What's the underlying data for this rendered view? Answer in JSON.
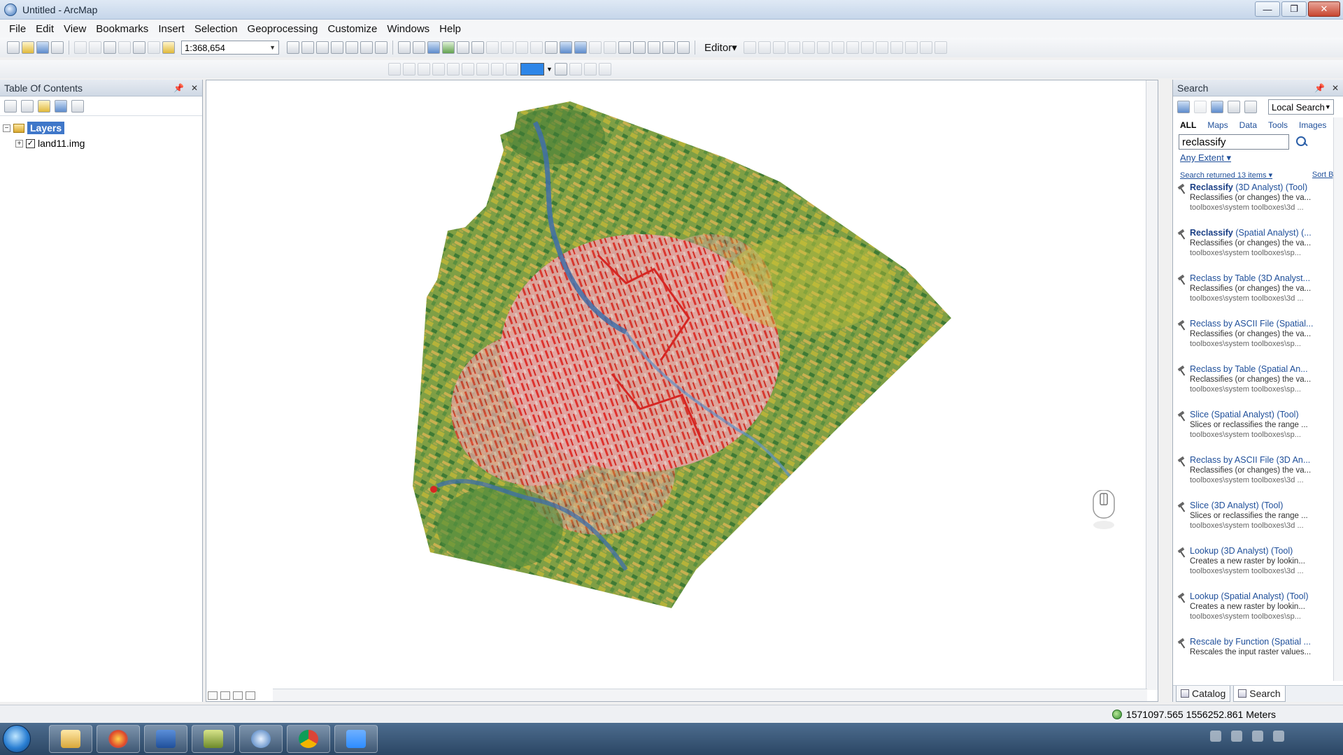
{
  "window": {
    "title": "Untitled - ArcMap",
    "minimize_glyph": "—",
    "restore_glyph": "❐",
    "close_glyph": "✕"
  },
  "menu": [
    "File",
    "Edit",
    "View",
    "Bookmarks",
    "Insert",
    "Selection",
    "Geoprocessing",
    "Customize",
    "Windows",
    "Help"
  ],
  "toolbar": {
    "scale": "1:368,654",
    "editor_label": "Editor▾"
  },
  "toc": {
    "title": "Table Of Contents",
    "tree": {
      "root_label": "Layers",
      "root_expander": "−",
      "layer_label": "land11.img",
      "layer_expander": "+",
      "layer_checked": "✓"
    }
  },
  "search": {
    "title": "Search",
    "scope": "Local Search",
    "filters": [
      "ALL",
      "Maps",
      "Data",
      "Tools",
      "Images"
    ],
    "query": "reclassify",
    "extent": "Any Extent ▾",
    "summary": "Search returned 13 items ▾",
    "sort": "Sort By",
    "results": [
      {
        "title_bold": "Reclassify",
        "title_rest": " (3D Analyst) (Tool)",
        "desc": "Reclassifies (or changes) the va...",
        "path": "toolboxes\\system toolboxes\\3d ..."
      },
      {
        "title_bold": "Reclassify",
        "title_rest": " (Spatial Analyst) (...",
        "desc": "Reclassifies (or changes) the va...",
        "path": "toolboxes\\system toolboxes\\sp..."
      },
      {
        "title_bold": "",
        "title_rest": "Reclass by Table (3D Analyst...",
        "desc": "Reclassifies (or changes) the va...",
        "path": "toolboxes\\system toolboxes\\3d ..."
      },
      {
        "title_bold": "",
        "title_rest": "Reclass by ASCII File (Spatial...",
        "desc": "Reclassifies (or changes) the va...",
        "path": "toolboxes\\system toolboxes\\sp..."
      },
      {
        "title_bold": "",
        "title_rest": "Reclass by Table (Spatial An...",
        "desc": "Reclassifies (or changes) the va...",
        "path": "toolboxes\\system toolboxes\\sp..."
      },
      {
        "title_bold": "",
        "title_rest": "Slice (Spatial Analyst) (Tool)",
        "desc": "Slices or reclassifies the range ...",
        "path": "toolboxes\\system toolboxes\\sp..."
      },
      {
        "title_bold": "",
        "title_rest": "Reclass by ASCII File (3D An...",
        "desc": "Reclassifies (or changes) the va...",
        "path": "toolboxes\\system toolboxes\\3d ..."
      },
      {
        "title_bold": "",
        "title_rest": "Slice (3D Analyst) (Tool)",
        "desc": "Slices or reclassifies the range ...",
        "path": "toolboxes\\system toolboxes\\3d ..."
      },
      {
        "title_bold": "",
        "title_rest": "Lookup (3D Analyst) (Tool)",
        "desc": "Creates a new raster by lookin...",
        "path": "toolboxes\\system toolboxes\\3d ..."
      },
      {
        "title_bold": "",
        "title_rest": "Lookup (Spatial Analyst) (Tool)",
        "desc": "Creates a new raster by lookin...",
        "path": "toolboxes\\system toolboxes\\sp..."
      },
      {
        "title_bold": "",
        "title_rest": "Rescale by Function (Spatial ...",
        "desc": "Rescales the input raster values...",
        "path": ""
      }
    ],
    "tab_catalog": "Catalog",
    "tab_search": "Search"
  },
  "status": {
    "coordinates": "1571097.565  1556252.861 Meters"
  },
  "colors": {
    "map_green": "#4f8a3a",
    "map_yellow": "#c8c23a",
    "map_red": "#e0302d",
    "map_pink": "#e7b4b2",
    "map_blue": "#3f6fa8",
    "selection_blue": "#3f77c9"
  },
  "taskbar": {
    "apps": [
      "explorer-icon",
      "ie-icon",
      "word-icon",
      "arcmap-folder-icon",
      "arcmap-icon",
      "chrome-icon",
      "zoom-icon"
    ]
  }
}
